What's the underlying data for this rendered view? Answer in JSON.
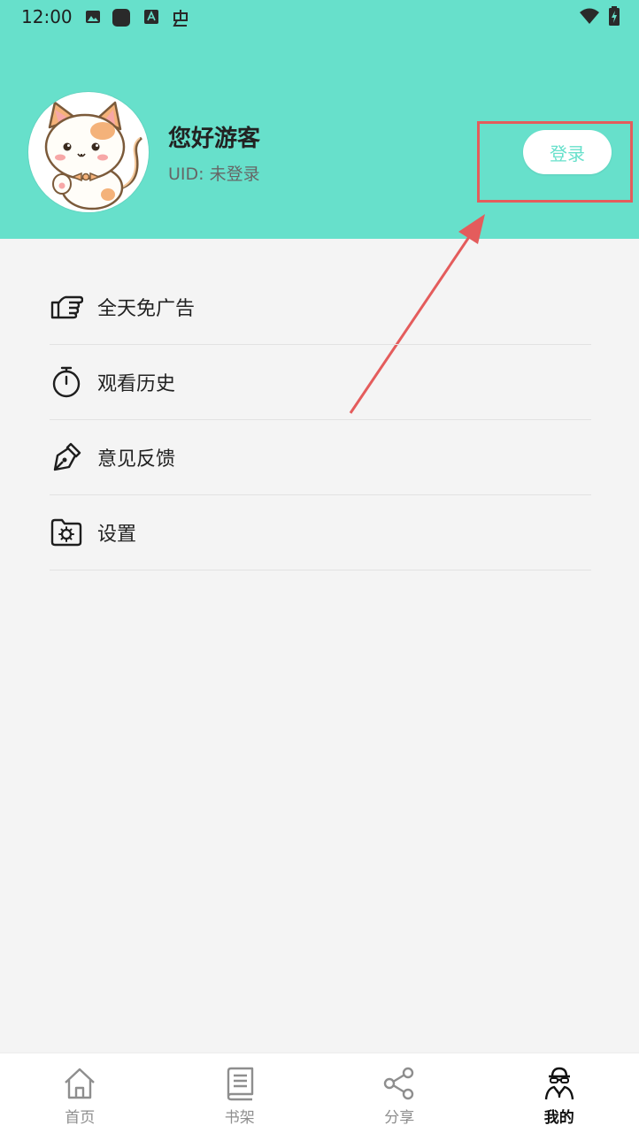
{
  "status_bar": {
    "time": "12:00"
  },
  "profile": {
    "greeting": "您好游客",
    "uid": "UID: 未登录",
    "login_label": "登录",
    "accent_color": "#67e0cb"
  },
  "menu": {
    "items": [
      {
        "label": "全天免广告",
        "icon": "pointing-hand-icon"
      },
      {
        "label": "观看历史",
        "icon": "stopwatch-icon"
      },
      {
        "label": "意见反馈",
        "icon": "pen-nib-icon"
      },
      {
        "label": "设置",
        "icon": "folder-gear-icon"
      }
    ]
  },
  "tabbar": {
    "tabs": [
      {
        "label": "首页",
        "icon": "home-icon"
      },
      {
        "label": "书架",
        "icon": "book-icon"
      },
      {
        "label": "分享",
        "icon": "share-icon"
      },
      {
        "label": "我的",
        "icon": "spy-profile-icon",
        "active": true
      }
    ]
  },
  "annotation": {
    "color": "#e45c5c"
  }
}
